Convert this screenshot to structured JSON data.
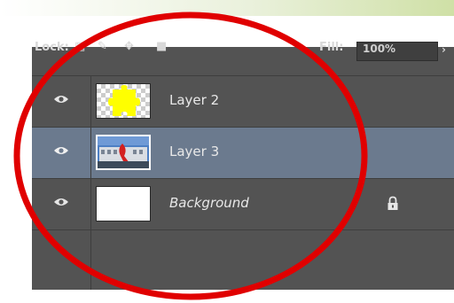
{
  "lock_bar": {
    "label": "Lock:",
    "fill_label": "Fill:",
    "fill_value": "100%"
  },
  "layers": [
    {
      "name": "Layer 2",
      "visible": true,
      "selected": false,
      "italic": false,
      "thumbnail": "yellow-puzzle-piece"
    },
    {
      "name": "Layer 3",
      "visible": true,
      "selected": true,
      "italic": false,
      "thumbnail": "building-photo"
    },
    {
      "name": "Background",
      "visible": true,
      "selected": false,
      "italic": true,
      "locked": true,
      "thumbnail": "white"
    }
  ],
  "icons": {
    "visibility": "eye-icon",
    "lock": "lock-icon"
  },
  "colors": {
    "panel_bg": "#535353",
    "selected_row": "#6b7a8e",
    "annotation_circle": "#e00000",
    "puzzle_fill": "#ffff00"
  }
}
